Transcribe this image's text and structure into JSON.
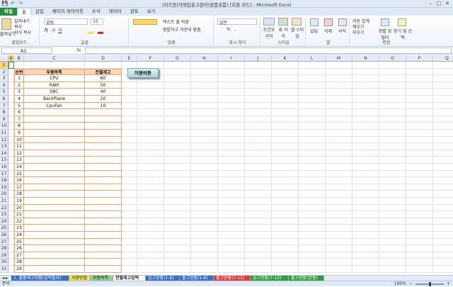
{
  "window": {
    "title": "(비즈몽)자재입출고관리(완품포함) [호환 모드] - Microsoft Excel",
    "minimize": "–",
    "maximize": "□",
    "close": "✕"
  },
  "qat": {
    "save": "💾",
    "undo": "↶",
    "redo": "↷"
  },
  "tabs": [
    "파일",
    "홈",
    "삽입",
    "페이지 레이아웃",
    "수식",
    "데이터",
    "검토",
    "보기"
  ],
  "ribbon": {
    "clipboard": {
      "label": "클립보드",
      "paste": "붙여넣기",
      "cut": "잘라내기",
      "copy": "복사",
      "format_painter": "서식 복사"
    },
    "font": {
      "label": "글꼴",
      "font_name": "굴림",
      "font_size": "10",
      "bold": "가",
      "italic": "가",
      "underline": "가"
    },
    "alignment": {
      "label": "맞춤",
      "wrap": "텍스트 줄 바꿈",
      "merge": "병합하고 가운데 맞춤"
    },
    "number": {
      "label": "표시 형식",
      "format": "일반",
      "percent": "%",
      "comma": ","
    },
    "styles": {
      "label": "스타일",
      "conditional": "조건부 서식",
      "table": "표 서식",
      "cell": "셀 스타일"
    },
    "cells": {
      "label": "셀",
      "insert": "삽입",
      "delete": "삭제",
      "format": "서식"
    },
    "editing": {
      "label": "편집",
      "autosum": "자동 합계",
      "fill": "채우기",
      "clear": "지우기",
      "sort": "정렬 및 필터",
      "find": "찾기 및 선택"
    }
  },
  "formula_bar": {
    "name_box": "A1",
    "fx": "fx",
    "value": ""
  },
  "columns": [
    "A",
    "B",
    "C",
    "D",
    "E",
    "F",
    "G",
    "H",
    "I",
    "J",
    "K",
    "L",
    "M",
    "N",
    "O",
    "P",
    "Q"
  ],
  "rows": [
    "1",
    "2",
    "3",
    "4",
    "5",
    "6",
    "7",
    "8",
    "9",
    "10",
    "11",
    "12",
    "13",
    "14",
    "15",
    "16",
    "17",
    "18",
    "19",
    "20",
    "21",
    "22",
    "23",
    "24",
    "25",
    "26",
    "27",
    "28",
    "29",
    "30",
    "31"
  ],
  "table": {
    "headers": [
      "순번",
      "부품목록",
      "전월재고"
    ],
    "rows": [
      [
        "1",
        "CPU",
        "60"
      ],
      [
        "2",
        "RAM",
        "50"
      ],
      [
        "3",
        "SBC",
        "40"
      ],
      [
        "4",
        "BackPlane",
        "20"
      ],
      [
        "5",
        "CpuFan",
        "10"
      ],
      [
        "6",
        "",
        ""
      ],
      [
        "7",
        "",
        ""
      ],
      [
        "8",
        "",
        ""
      ],
      [
        "9",
        "",
        ""
      ],
      [
        "10",
        "",
        ""
      ],
      [
        "11",
        "",
        ""
      ],
      [
        "12",
        "",
        ""
      ],
      [
        "13",
        "",
        ""
      ],
      [
        "14",
        "",
        ""
      ],
      [
        "15",
        "",
        ""
      ],
      [
        "16",
        "",
        ""
      ],
      [
        "17",
        "",
        ""
      ],
      [
        "18",
        "",
        ""
      ],
      [
        "19",
        "",
        ""
      ],
      [
        "20",
        "",
        ""
      ],
      [
        "21",
        "",
        ""
      ],
      [
        "22",
        "",
        ""
      ],
      [
        "23",
        "",
        ""
      ],
      [
        "24",
        "",
        ""
      ],
      [
        "25",
        "",
        ""
      ],
      [
        "26",
        "",
        ""
      ],
      [
        "27",
        "",
        ""
      ],
      [
        "28",
        "",
        ""
      ],
      [
        "29",
        "",
        ""
      ]
    ]
  },
  "move_button": "이동버튼",
  "sheets": [
    {
      "name": "1. 물품재고현황(입력필요)",
      "color": "#3a6fc4"
    },
    {
      "name": "사용방법",
      "color": "#f2e24a"
    },
    {
      "name": "부품목록",
      "color": "#8fd18a"
    },
    {
      "name": "전월재고입력",
      "color": "#ffffff"
    },
    {
      "name": "입고현황(1-6)",
      "color": "#3a6fc4"
    },
    {
      "name": "출고현황(1-6)",
      "color": "#3a6fc4"
    },
    {
      "name": "출고현황(7-12)",
      "color": "#e03a3a"
    },
    {
      "name": "입고현황(7-12)",
      "color": "#2e9e3a"
    },
    {
      "name": "출고현황(완품)",
      "color": "#2e9e3a"
    }
  ],
  "status": {
    "ready": "준비",
    "zoom": "100%",
    "zoom_minus": "−",
    "zoom_plus": "+"
  }
}
